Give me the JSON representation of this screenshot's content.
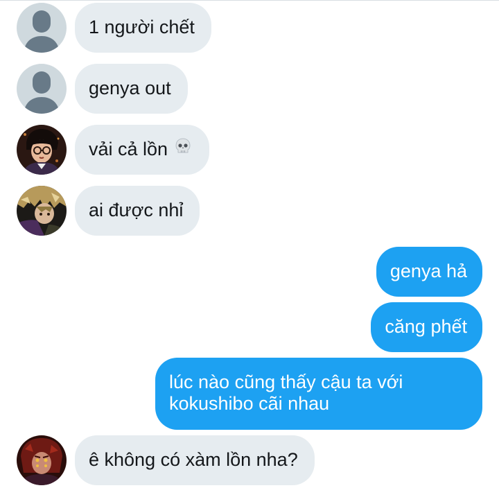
{
  "messages": [
    {
      "direction": "in",
      "avatar": "default-avatar",
      "text": "1 người chết"
    },
    {
      "direction": "in",
      "avatar": "default-avatar",
      "text": "genya out"
    },
    {
      "direction": "in",
      "avatar": "anime-avatar-glasses",
      "text": "vải cả lồn",
      "emoji": "skull-emoji"
    },
    {
      "direction": "in",
      "avatar": "anime-avatar-blonde",
      "text": "ai được nhỉ"
    },
    {
      "direction": "out",
      "text": "genya hả"
    },
    {
      "direction": "out",
      "text": "căng phết"
    },
    {
      "direction": "out",
      "text": "lúc nào cũng thấy cậu ta với kokushibo cãi nhau"
    },
    {
      "direction": "in",
      "avatar": "anime-avatar-red",
      "text": "ê không có xàm lồn nha?"
    }
  ],
  "colors": {
    "incoming_bubble": "#e6ecf0",
    "outgoing_bubble": "#1da1f2",
    "incoming_text": "#14171a",
    "outgoing_text": "#ffffff",
    "default_avatar_bg": "#cfd9de",
    "default_avatar_fg": "#687a88"
  }
}
